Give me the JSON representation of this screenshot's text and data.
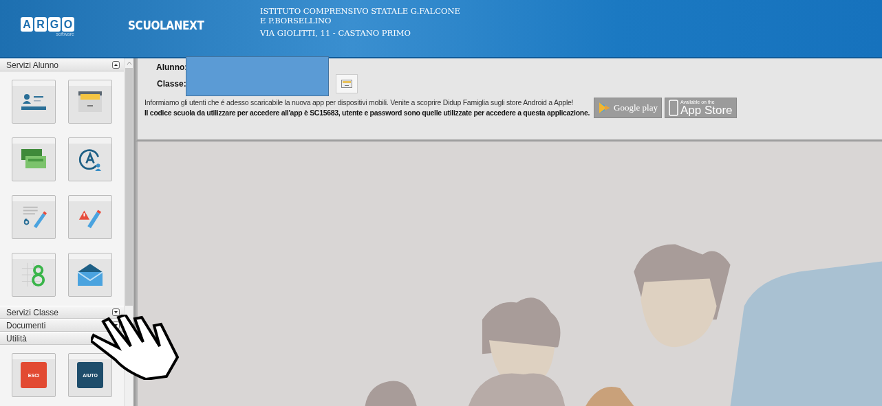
{
  "header": {
    "logo_letters": [
      "A",
      "R",
      "G",
      "O"
    ],
    "logo_subtitle": "software",
    "product": "SCUOLANEXT",
    "school_lines": [
      "ISTITUTO COMPRENSIVO STATALE G.FALCONE",
      "E P.BORSELLINO",
      "VIA GIOLITTI, 11 - CASTANO PRIMO"
    ]
  },
  "sidebar": {
    "sections": [
      {
        "title": "Servizi Alunno",
        "expanded": true,
        "kind": "icons"
      },
      {
        "title": "Servizi Classe",
        "expanded": false
      },
      {
        "title": "Documenti",
        "expanded": false
      },
      {
        "title": "Utilità",
        "expanded": true,
        "kind": "buttons",
        "buttons": [
          {
            "label": "ESCI",
            "color": "#e24a32"
          },
          {
            "label": "AIUTO",
            "color": "#1e4d6b"
          }
        ]
      }
    ]
  },
  "student": {
    "fields": [
      {
        "label": "Alunno:"
      },
      {
        "label": "Classe:"
      }
    ]
  },
  "notice": {
    "lines": [
      "Informiamo gli utenti che é adesso scaricabile la nuova app per dispositivi mobili. Venite a scoprire Didup Famiglia sugli store Android a Apple!",
      "Il codice scuola da utilizzare per accedere all'app è SC15683, utente e password sono quelle utilizzate per accedere a questa applicazione."
    ]
  },
  "stores": [
    {
      "kind": "google",
      "label": "Google play"
    },
    {
      "kind": "apple",
      "small": "Available on the",
      "label": "App Store"
    }
  ]
}
